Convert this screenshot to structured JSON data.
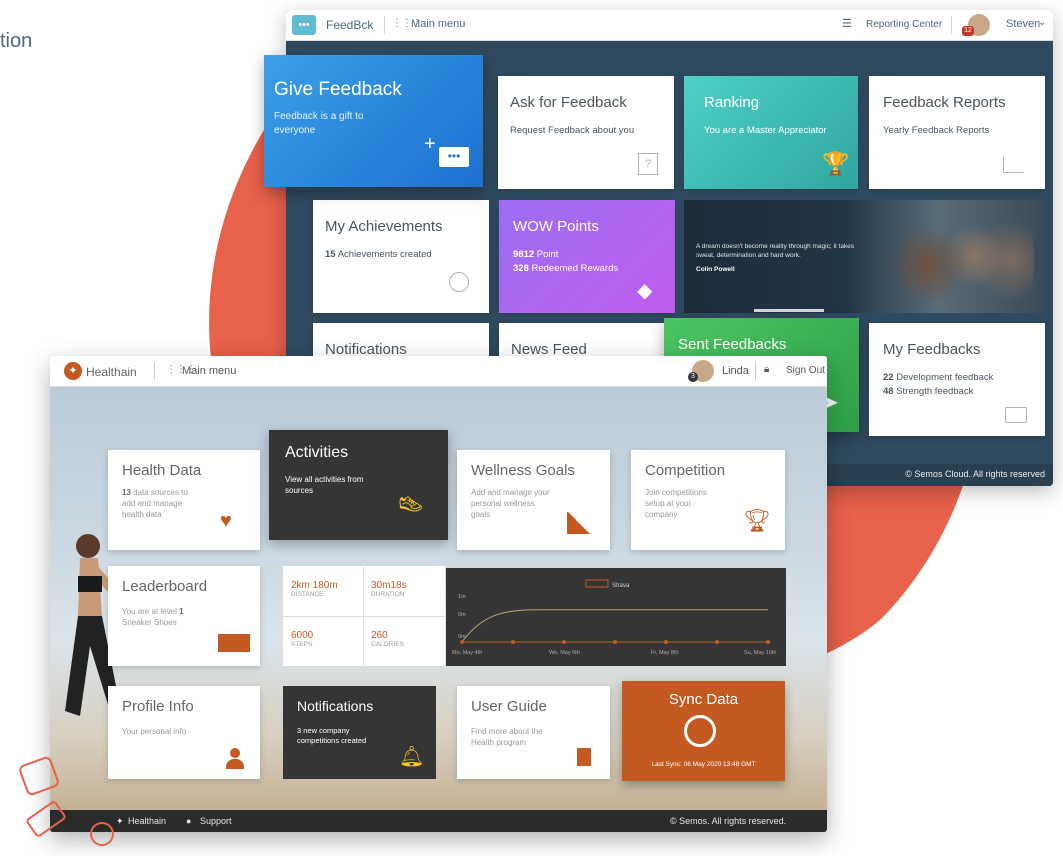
{
  "corner_text": "tion",
  "back": {
    "brand": "FeedBck",
    "main_menu": "Main menu",
    "reporting_center": "Reporting Center",
    "user_name": "Steven",
    "user_badge": "12",
    "footer": "© Semos Cloud. All rights reserved",
    "tiles": {
      "give_feedback": {
        "title": "Give Feedback",
        "sub": "Feedback is a gift to everyone"
      },
      "ask_feedback": {
        "title": "Ask for Feedback",
        "sub": "Request Feedback about you"
      },
      "ranking": {
        "title": "Ranking",
        "sub": "You are a Master Appreciator"
      },
      "feedback_reports": {
        "title": "Feedback Reports",
        "sub": "Yearly Feedback Reports"
      },
      "achievements": {
        "title": "My Achievements",
        "count": "15",
        "sub": "Achievements created"
      },
      "wow_points": {
        "title": "WOW Points",
        "points_num": "9812",
        "points_label": "Point",
        "redeemed_num": "328",
        "redeemed_label": "Redeemed Rewards"
      },
      "quote": {
        "text": "A dream doesn't become reality through magic; it takes sweat, determination and hard work.",
        "author": "Colin Powell"
      },
      "notifications": {
        "title": "Notifications"
      },
      "news_feed": {
        "title": "News Feed"
      },
      "sent_feedbacks": {
        "title": "Sent Feedbacks"
      },
      "my_feedbacks": {
        "title": "My Feedbacks",
        "dev_num": "22",
        "dev_label": "Development feedback",
        "str_num": "48",
        "str_label": "Strength feedback"
      }
    }
  },
  "front": {
    "brand": "Healthain",
    "main_menu": "Main menu",
    "user_name": "Linda",
    "user_badge": "3",
    "sign_out": "Sign Out",
    "footer_brand": "Healthain",
    "footer_support": "Support",
    "footer_copy": "© Semos. All rights reserved.",
    "tiles": {
      "health_data": {
        "title": "Health Data",
        "count": "13",
        "sub": "data sources to add and manage health data"
      },
      "activities": {
        "title": "Activities",
        "sub": "View all activities from sources"
      },
      "wellness": {
        "title": "Wellness Goals",
        "sub": "Add and manage your personal wellness goals"
      },
      "competition": {
        "title": "Competition",
        "sub": "Join competitions setup at your company"
      },
      "leaderboard": {
        "title": "Leaderboard",
        "sub_prefix": "You are at level",
        "level": "1",
        "sub2": "Sneaker Shoes"
      },
      "profile": {
        "title": "Profile Info",
        "sub": "Your personal info"
      },
      "notifications": {
        "title": "Notifications",
        "sub": "3 new company competitions created"
      },
      "user_guide": {
        "title": "User Guide",
        "sub": "Find more about the Health program"
      },
      "sync": {
        "title": "Sync Data",
        "sub": "Last Sync: 06 May 2020 13:48 GMT"
      }
    },
    "stats": [
      {
        "value": "2km 180m",
        "label": "DISTANCE"
      },
      {
        "value": "30m18s",
        "label": "DURATION"
      },
      {
        "value": "6000",
        "label": "STEPS"
      },
      {
        "value": "260",
        "label": "CALORIES"
      }
    ]
  },
  "chart_data": {
    "type": "line",
    "legend": "Strava",
    "y_ticks": [
      "1m",
      "0m",
      "0m"
    ],
    "categories": [
      "Mo, May 4th",
      "We, May 6th",
      "Fr, May 8th",
      "Su, May 10th"
    ],
    "series": [
      {
        "name": "Strava",
        "values": [
          0,
          0.6,
          0.7,
          0.7,
          0.7,
          0.7,
          0.7
        ]
      },
      {
        "values": [
          0,
          0,
          0,
          0,
          0,
          0,
          0
        ]
      }
    ],
    "colors": {
      "line": "#b8a86a",
      "points": "#c45a22"
    }
  }
}
